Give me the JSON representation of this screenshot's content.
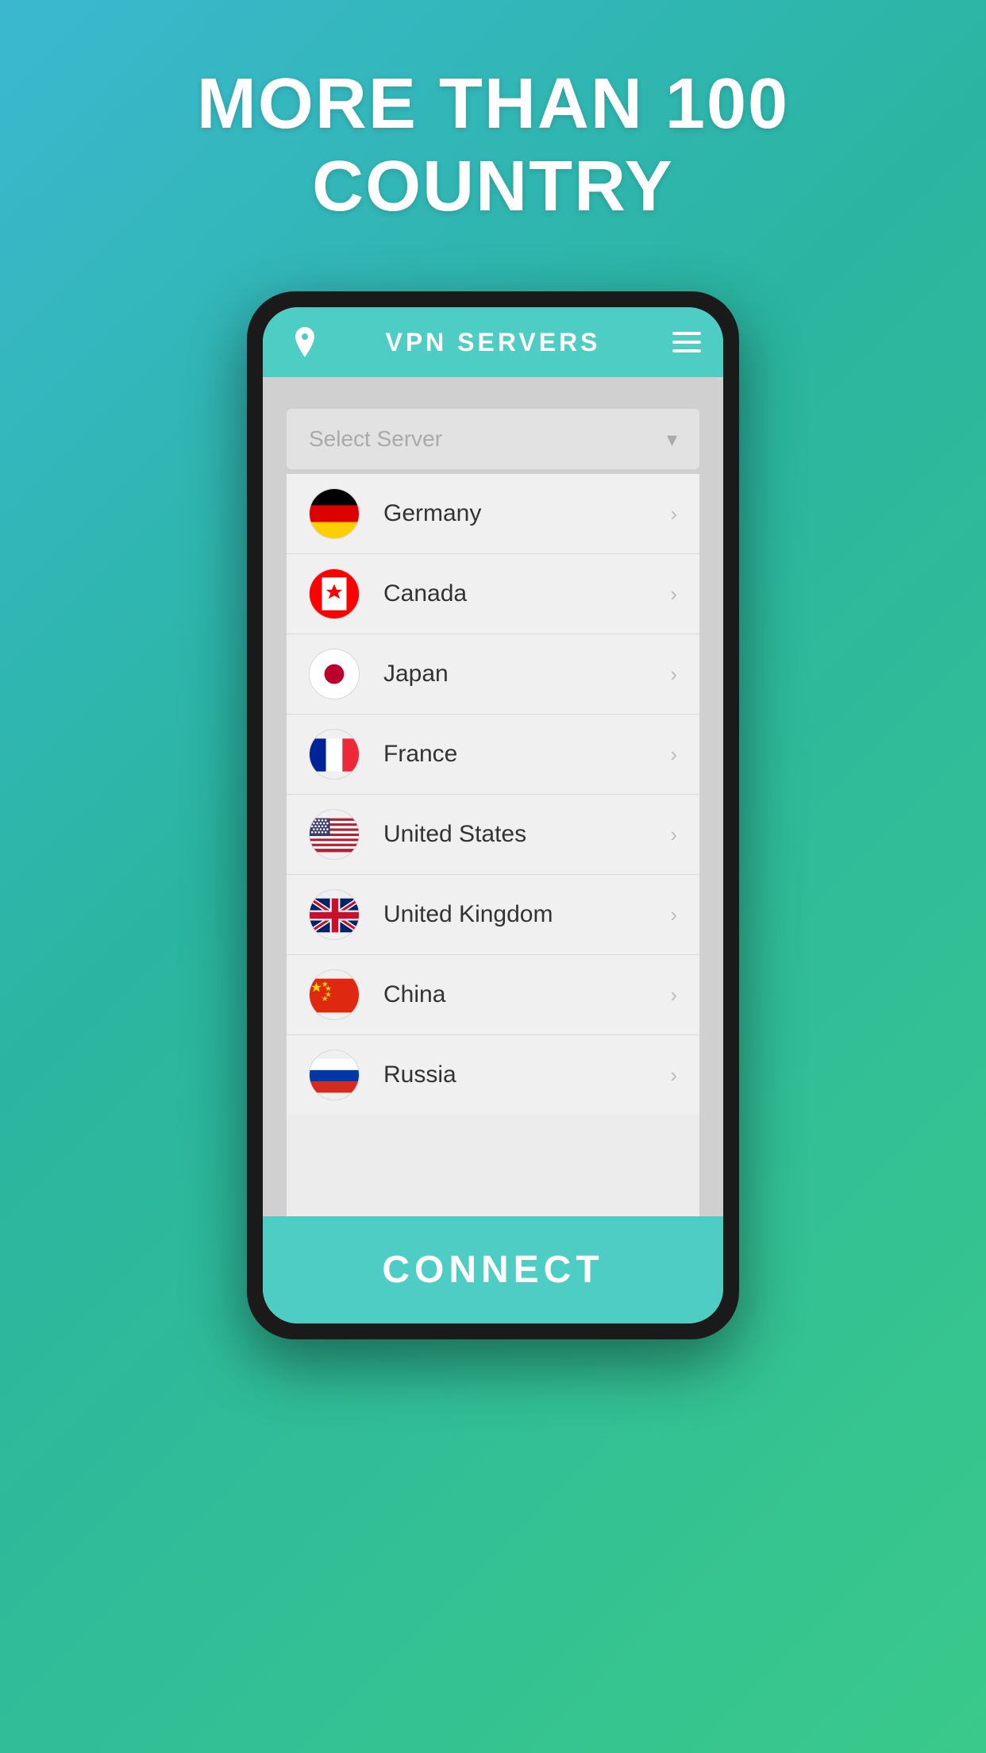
{
  "headline": {
    "line1": "MORE THAN 100",
    "line2": "COUNTRY"
  },
  "appbar": {
    "title": "VPN SERVERS",
    "icon_name": "location-pin"
  },
  "dropdown": {
    "placeholder": "Select Server",
    "chevron": "▾"
  },
  "countries": [
    {
      "name": "Germany",
      "flag": "germany"
    },
    {
      "name": "Canada",
      "flag": "canada"
    },
    {
      "name": "Japan",
      "flag": "japan"
    },
    {
      "name": "France",
      "flag": "france"
    },
    {
      "name": "United States",
      "flag": "us"
    },
    {
      "name": "United Kingdom",
      "flag": "uk"
    },
    {
      "name": "China",
      "flag": "china"
    },
    {
      "name": "Russia",
      "flag": "russia"
    }
  ],
  "connect_button": "CONNECT",
  "colors": {
    "teal": "#4ecdc4",
    "background_start": "#3bb8d0",
    "background_end": "#3ac98a"
  }
}
